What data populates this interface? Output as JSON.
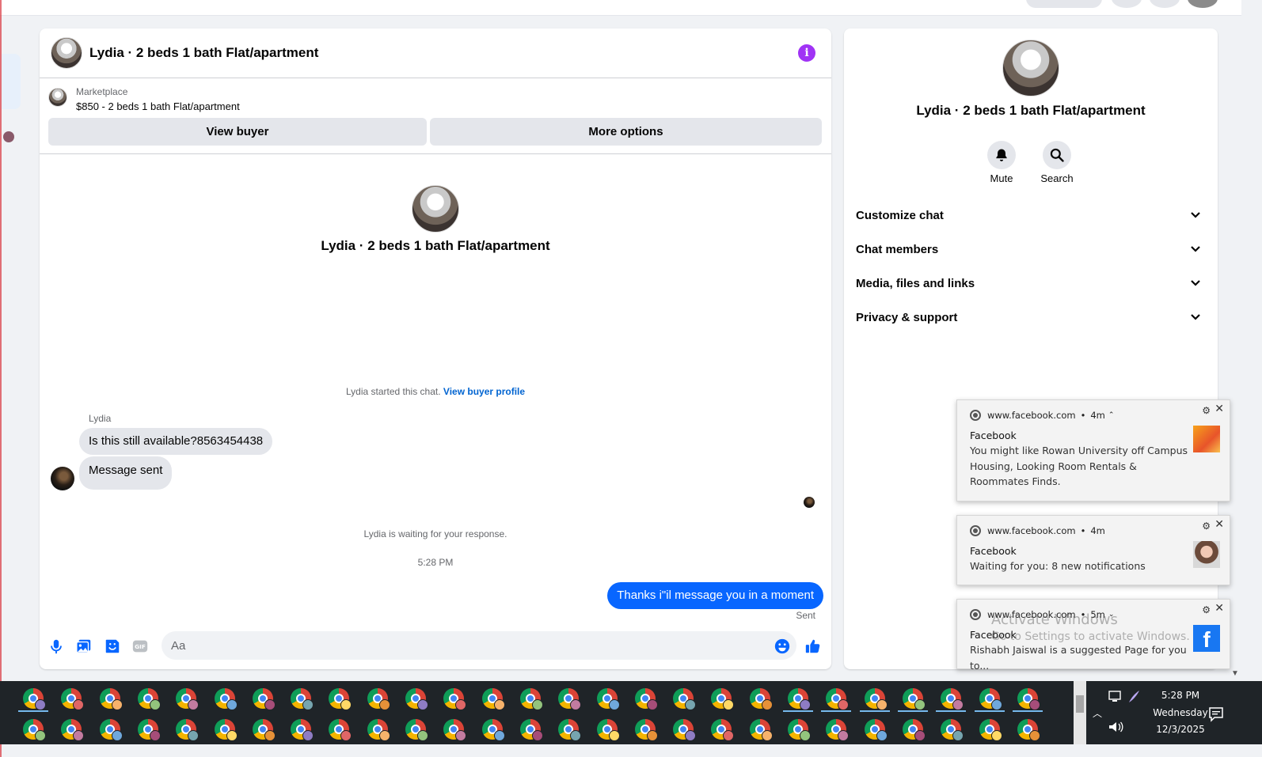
{
  "chat": {
    "title": "Lydia · 2 beds 1 bath Flat/apartment",
    "marketplace_label": "Marketplace",
    "listing": "$850 - 2 beds 1 bath Flat/apartment",
    "view_buyer": "View buyer",
    "more_options": "More options",
    "intro_title": "Lydia · 2 beds 1 bath Flat/apartment",
    "started_text": "Lydia started this chat.",
    "view_buyer_profile": "View buyer profile",
    "sender": "Lydia",
    "messages_in": [
      "Is this still available?8563454438",
      "Message sent"
    ],
    "waiting": "Lydia is waiting for your response.",
    "time": "5:28 PM",
    "message_out": "Thanks i\"il message you in a moment",
    "sent_status": "Sent",
    "input_placeholder": "Aa"
  },
  "info_panel": {
    "title": "Lydia · 2 beds 1 bath Flat/apartment",
    "mute": "Mute",
    "search": "Search",
    "sections": [
      "Customize chat",
      "Chat members",
      "Media, files and links",
      "Privacy & support"
    ]
  },
  "notifications": [
    {
      "source": "www.facebook.com",
      "age": "4m",
      "title": "Facebook",
      "body": "You might like Rowan University off Campus Housing, Looking Room Rentals & Roommates Finds."
    },
    {
      "source": "www.facebook.com",
      "age": "4m",
      "title": "Facebook",
      "body": "Waiting for you: 8 new notifications"
    },
    {
      "source": "www.facebook.com",
      "age": "5m",
      "title": "Facebook",
      "body": "Rishabh Jaiswal is a suggested Page for you to..."
    }
  ],
  "watermark": {
    "line1": "Activate Windows",
    "line2": "Go to Settings to activate Windows."
  },
  "clock": {
    "time": "5:28 PM",
    "day": "Wednesday",
    "date": "12/3/2025"
  },
  "colors": {
    "accent": "#0866ff",
    "link": "#0064d1",
    "info_icon": "#a033f5",
    "taskbar": "#1f2428"
  },
  "icons": [
    "info-icon",
    "microphone-icon",
    "photo-icon",
    "sticker-icon",
    "gif-icon",
    "emoji-icon",
    "thumbs-up-icon",
    "bell-icon",
    "search-icon",
    "chevron-down-icon",
    "gear-icon",
    "close-icon",
    "chrome-icon"
  ]
}
